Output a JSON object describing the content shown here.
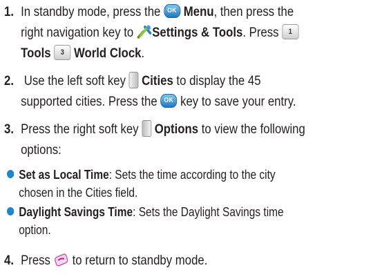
{
  "steps": [
    {
      "number": "1.",
      "line1": {
        "a": "In standby mode, press the ",
        "ok": "OK",
        "b": " ",
        "menu": "Menu",
        "c": ", then press the"
      },
      "line2": {
        "a": "right navigation key to ",
        "settings": "Settings & Tools",
        "b": ". Press "
      },
      "line3": {
        "tools": "Tools",
        "world": "World Clock",
        "end": "."
      }
    },
    {
      "number": "2.",
      "line1": {
        "a": " Use the left soft key ",
        "cities": "Cities",
        "b": " to display the 45"
      },
      "line2": {
        "a": "supported cities. Press the ",
        "ok": "OK",
        "b": " key to save your entry."
      }
    },
    {
      "number": "3.",
      "line1": {
        "a": "Press the right soft key ",
        "options": "Options",
        "b": " to view the following"
      },
      "line2": "options:"
    },
    {
      "number": "4.",
      "line1": {
        "a": "Press ",
        "b": " to return to standby mode."
      }
    }
  ],
  "bullets": [
    {
      "term": "Set as Local Time",
      "line1": ": Sets the time according to the city",
      "line2": "chosen in the Cities field."
    },
    {
      "term": "Daylight Savings Time",
      "line1": ": Sets the Daylight Savings time",
      "line2": "option."
    }
  ],
  "icons": {
    "ok": "ok-key-icon",
    "settings": "settings-tools-icon",
    "key1": "key-1-icon",
    "key1_label": "1",
    "key3": "key-3-icon",
    "key3_label": "3",
    "left_soft": "left-soft-key-icon",
    "right_soft": "right-soft-key-icon",
    "end": "end-key-icon"
  },
  "colors": {
    "text": "#231f20",
    "bullet": "#1e86c9",
    "ok_key": "#1f79c1"
  }
}
